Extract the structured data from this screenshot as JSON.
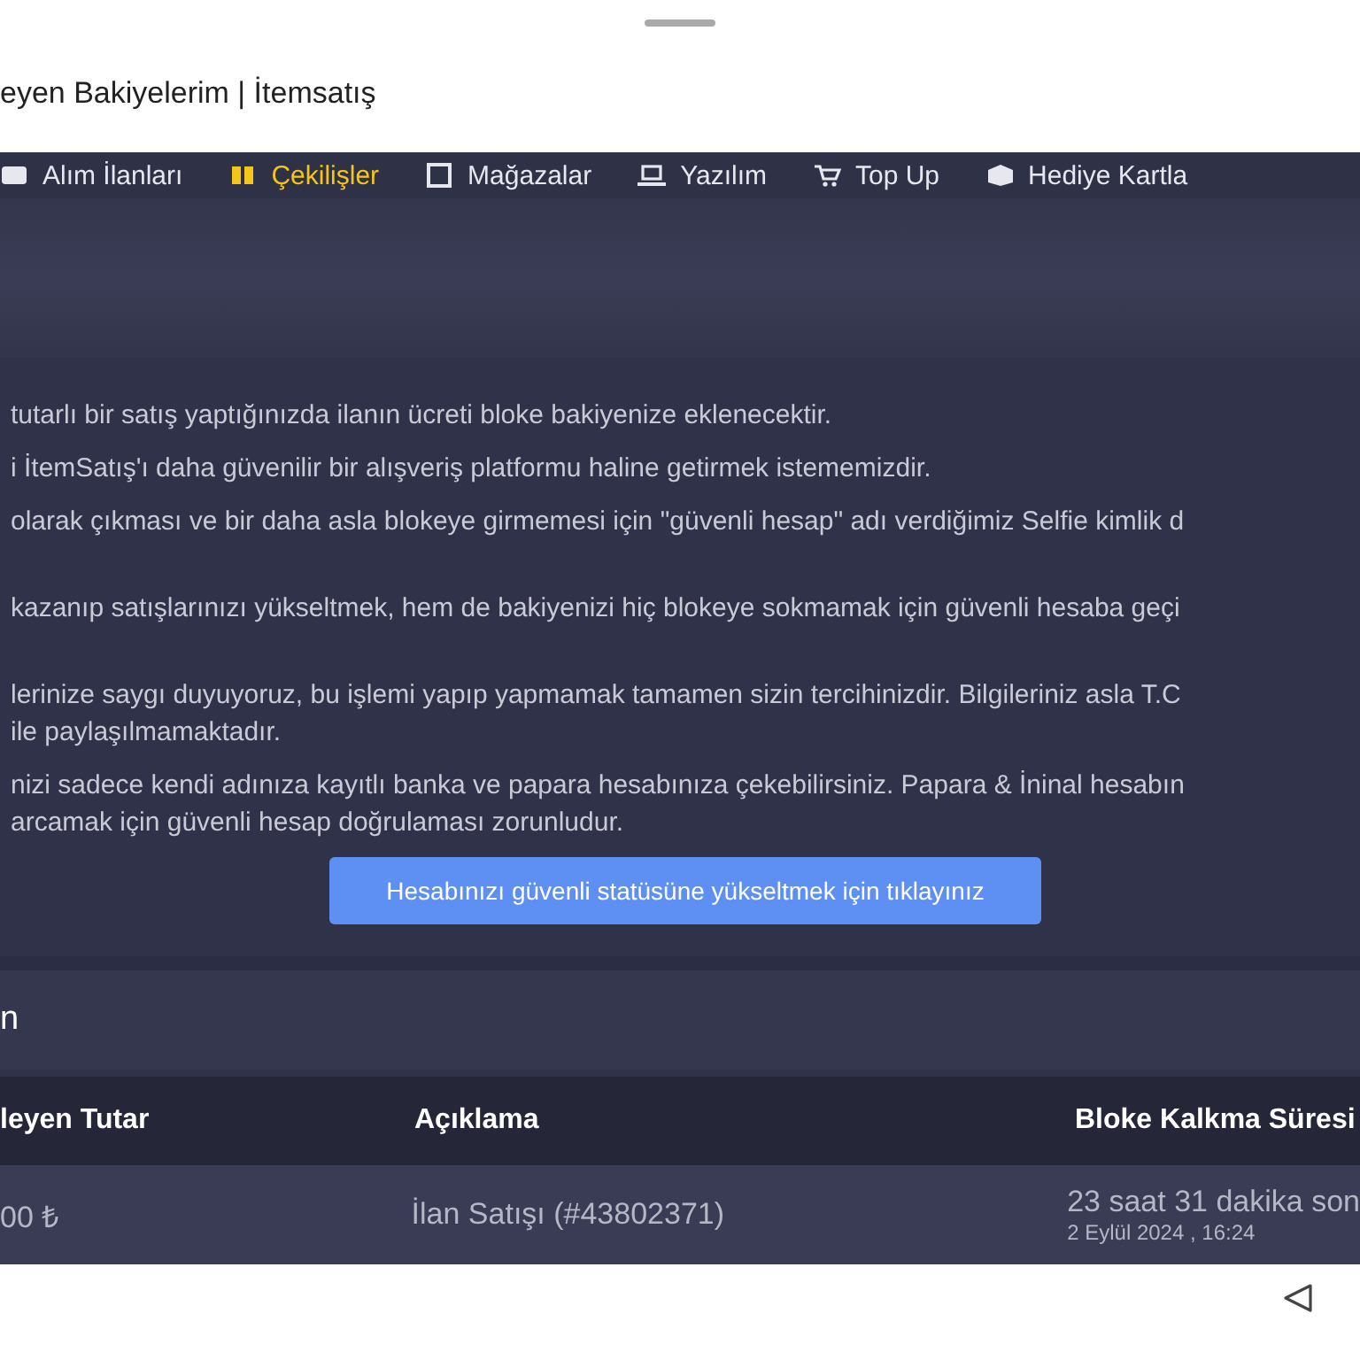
{
  "browser": {
    "title": "eyen Bakiyelerim | İtemsatış"
  },
  "nav": [
    {
      "label": "Alım İlanları",
      "selected": false
    },
    {
      "label": "Çekilişler",
      "selected": true
    },
    {
      "label": "Mağazalar",
      "selected": false
    },
    {
      "label": "Yazılım",
      "selected": false
    },
    {
      "label": "Top Up",
      "selected": false
    },
    {
      "label": "Hediye Kartla",
      "selected": false
    }
  ],
  "paragraphs": [
    {
      "lines": [
        "tutarlı bir satış yaptığınızda ilanın ücreti bloke bakiyenize eklenecektir."
      ]
    },
    {
      "lines": [
        "i İtemSatış'ı daha güvenilir bir alışveriş platformu haline getirmek istememizdir."
      ]
    },
    {
      "lines": [
        "olarak çıkması ve bir daha asla blokeye girmemesi için \"güvenli hesap\" adı verdiğimiz Selfie kimlik d"
      ]
    },
    {
      "lines": [
        "kazanıp satışlarınızı yükseltmek, hem de bakiyenizi hiç blokeye sokmamak için güvenli hesaba geçi"
      ]
    },
    {
      "lines": [
        "lerinize saygı duyuyoruz, bu işlemi yapıp yapmamak tamamen sizin tercihinizdir. Bilgileriniz asla T.C",
        "ile paylaşılmamaktadır."
      ]
    },
    {
      "lines": [
        "nizi sadece kendi adınıza kayıtlı banka ve papara hesabınıza çekebilirsiniz. Papara & İninal hesabın",
        "arcamak için güvenli hesap doğrulaması zorunludur."
      ]
    }
  ],
  "upgrade_button": "Hesabınızı güvenli statüsüne yükseltmek için tıklayınız",
  "section": {
    "title": "n"
  },
  "table": {
    "columns": [
      "leyen Tutar",
      "Açıklama",
      "Bloke Kalkma Süresi"
    ],
    "rows": [
      {
        "amount": "00 ₺",
        "description": "İlan Satışı (#43802371)",
        "remaining": "23 saat 31 dakika son",
        "date": "2 Eylül 2024 , 16:24"
      }
    ]
  }
}
